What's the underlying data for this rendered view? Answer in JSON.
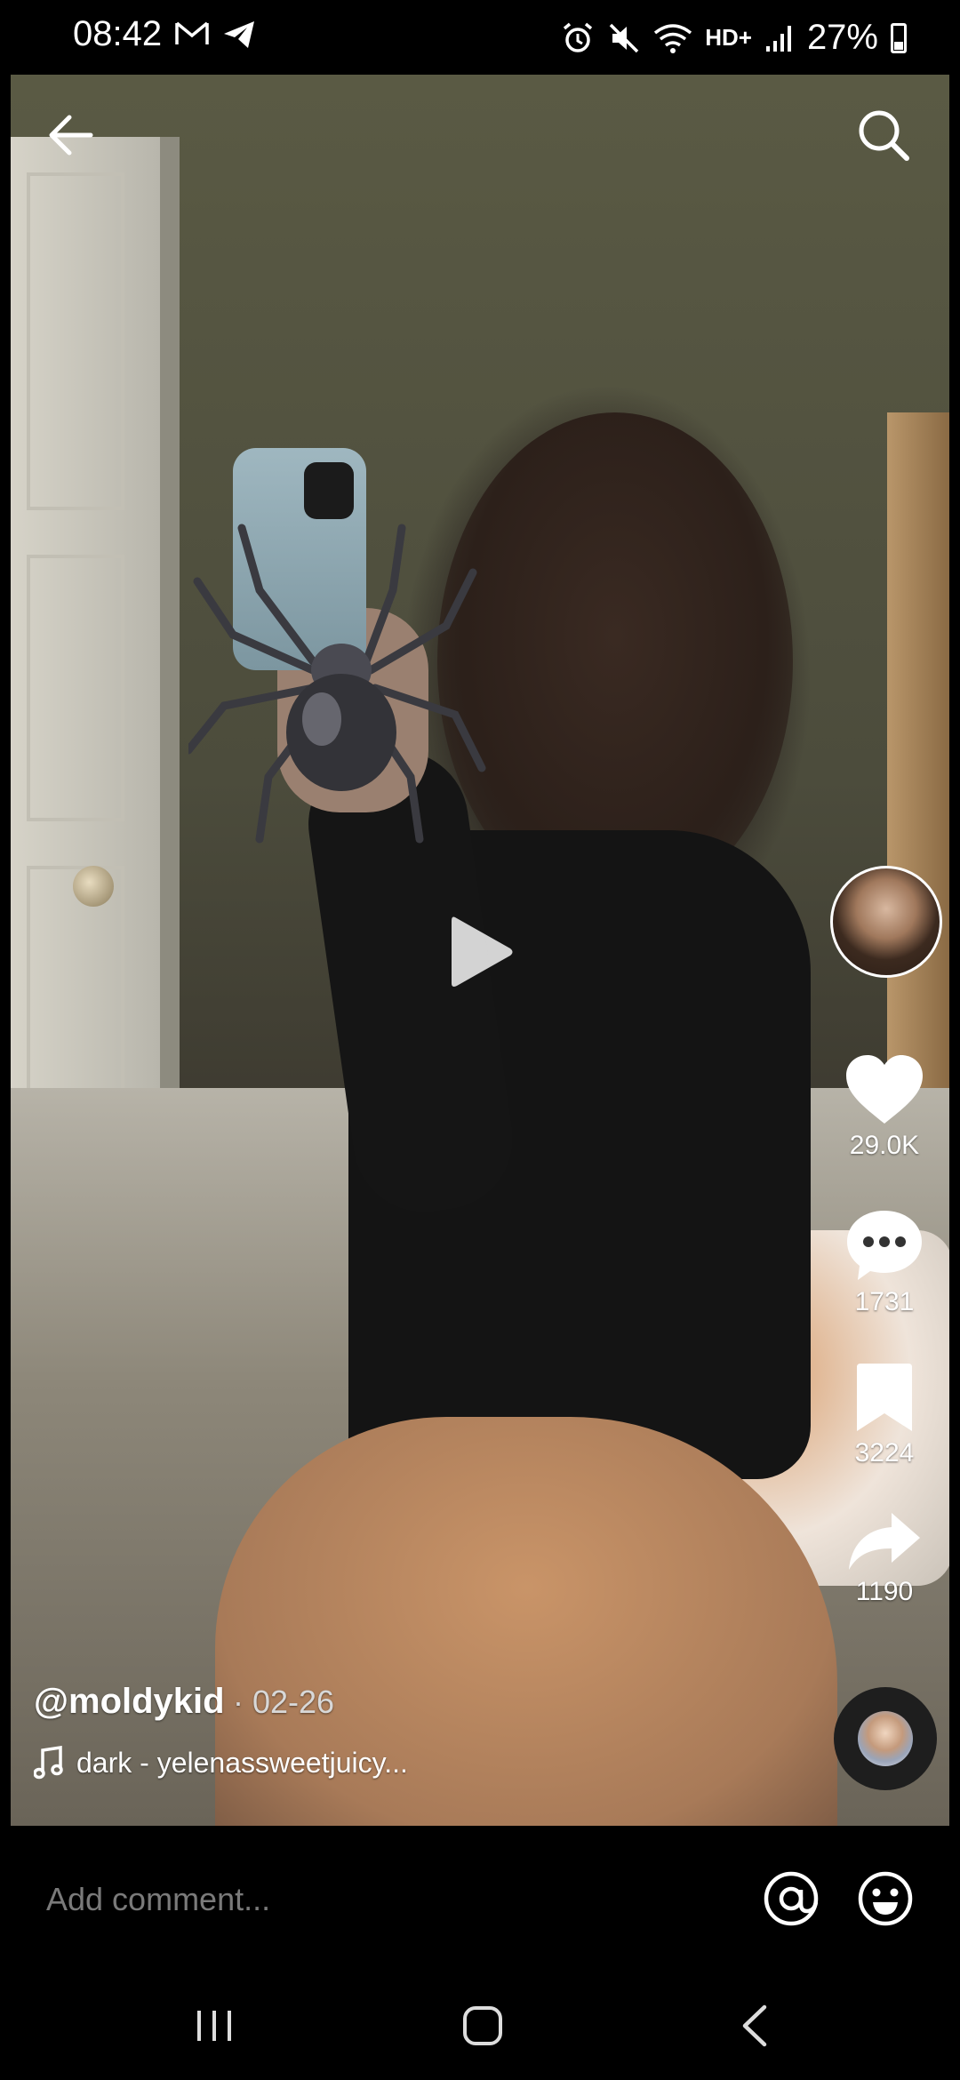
{
  "status_bar": {
    "time": "08:42",
    "network": "HD+",
    "battery": "27%"
  },
  "icons": {
    "back": "arrow-left-icon",
    "search": "search-icon",
    "play": "play-icon",
    "like": "heart-icon",
    "comment": "comment-bubble-icon",
    "favorite": "bookmark-icon",
    "share": "share-arrow-icon",
    "music": "music-note-icon",
    "mention": "at-sign-icon",
    "emoji": "smiley-icon"
  },
  "actions": {
    "likes": "29.0K",
    "comments": "1731",
    "saves": "3224",
    "shares": "1190"
  },
  "post": {
    "author": "@moldykid",
    "date": "· 02-26",
    "sound": "dark - yelenassweetjuicy..."
  },
  "comment_bar": {
    "placeholder": "Add comment..."
  },
  "colors": {
    "background": "#000000",
    "text": "#ffffff",
    "placeholder": "#7a7a7a"
  }
}
